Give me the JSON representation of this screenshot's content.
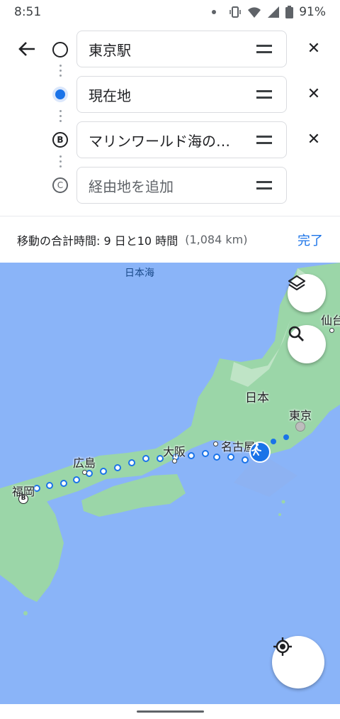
{
  "status": {
    "time": "8:51",
    "battery": "91%"
  },
  "route": {
    "back_label": "",
    "waypoints": [
      {
        "label": "東京駅",
        "marker": "",
        "placeholder": false
      },
      {
        "label": "現在地",
        "marker": "",
        "placeholder": false
      },
      {
        "label": "マリンワールド海の…",
        "marker": "B",
        "placeholder": false
      },
      {
        "label": "経由地を追加",
        "marker": "C",
        "placeholder": true
      }
    ]
  },
  "summary": {
    "text": "移動の合計時間: 9 日と10 時間",
    "distance": "(1,084 km)",
    "done_label": "完了"
  },
  "map": {
    "sea_label": "日本海",
    "cities": {
      "sendai": "仙台",
      "japan": "日本",
      "tokyo": "東京",
      "nagoya": "名古屋",
      "osaka": "大阪",
      "hiroshima": "広島",
      "fukuoka": "福岡"
    },
    "marker_b": "B",
    "colors": {
      "water": "#8ab4f8",
      "land": "#9bd6a8",
      "route": "#1a73e8"
    }
  },
  "icons": {
    "back": "arrow-left-icon",
    "drag": "drag-handle-icon",
    "remove": "close-icon",
    "layers": "layers-icon",
    "search": "search-icon",
    "location": "my-location-icon",
    "walker": "walking-person-icon"
  }
}
